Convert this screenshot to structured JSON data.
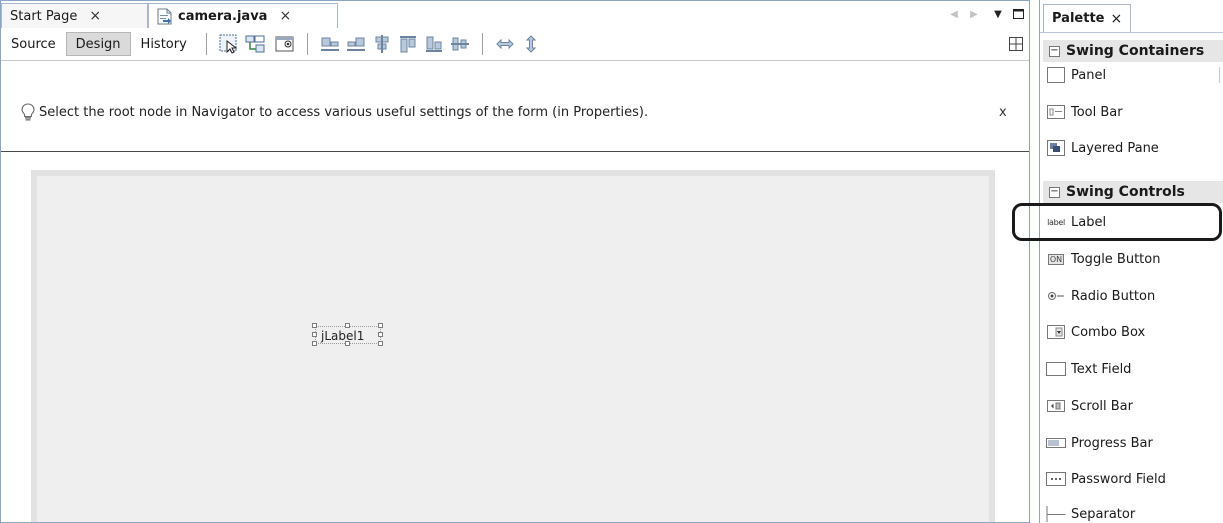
{
  "editor": {
    "tabs": [
      {
        "label": "Start Page",
        "close": "×"
      },
      {
        "label": "camera.java",
        "close": "×"
      }
    ],
    "view_buttons": [
      "Source",
      "Design",
      "History"
    ],
    "hint": {
      "text": "Select the root node in Navigator to access various useful settings of the form (in Properties).",
      "close": "x"
    },
    "form": {
      "label_text": "jLabel1"
    }
  },
  "palette": {
    "tab_label": "Palette",
    "tab_close": "×",
    "categories": [
      {
        "label": "Swing Containers",
        "items": [
          "Panel",
          "Tool Bar",
          "Layered Pane"
        ]
      },
      {
        "label": "Swing Controls",
        "items": [
          "Label",
          "Toggle Button",
          "Radio Button",
          "Combo Box",
          "Text Field",
          "Scroll Bar",
          "Progress Bar",
          "Password Field",
          "Separator"
        ]
      }
    ],
    "label_icon_text": "label",
    "toggle_icon_text": "ON"
  },
  "colors": {
    "accent_border": "#8da5c4",
    "callout": "#1a1a1a"
  }
}
